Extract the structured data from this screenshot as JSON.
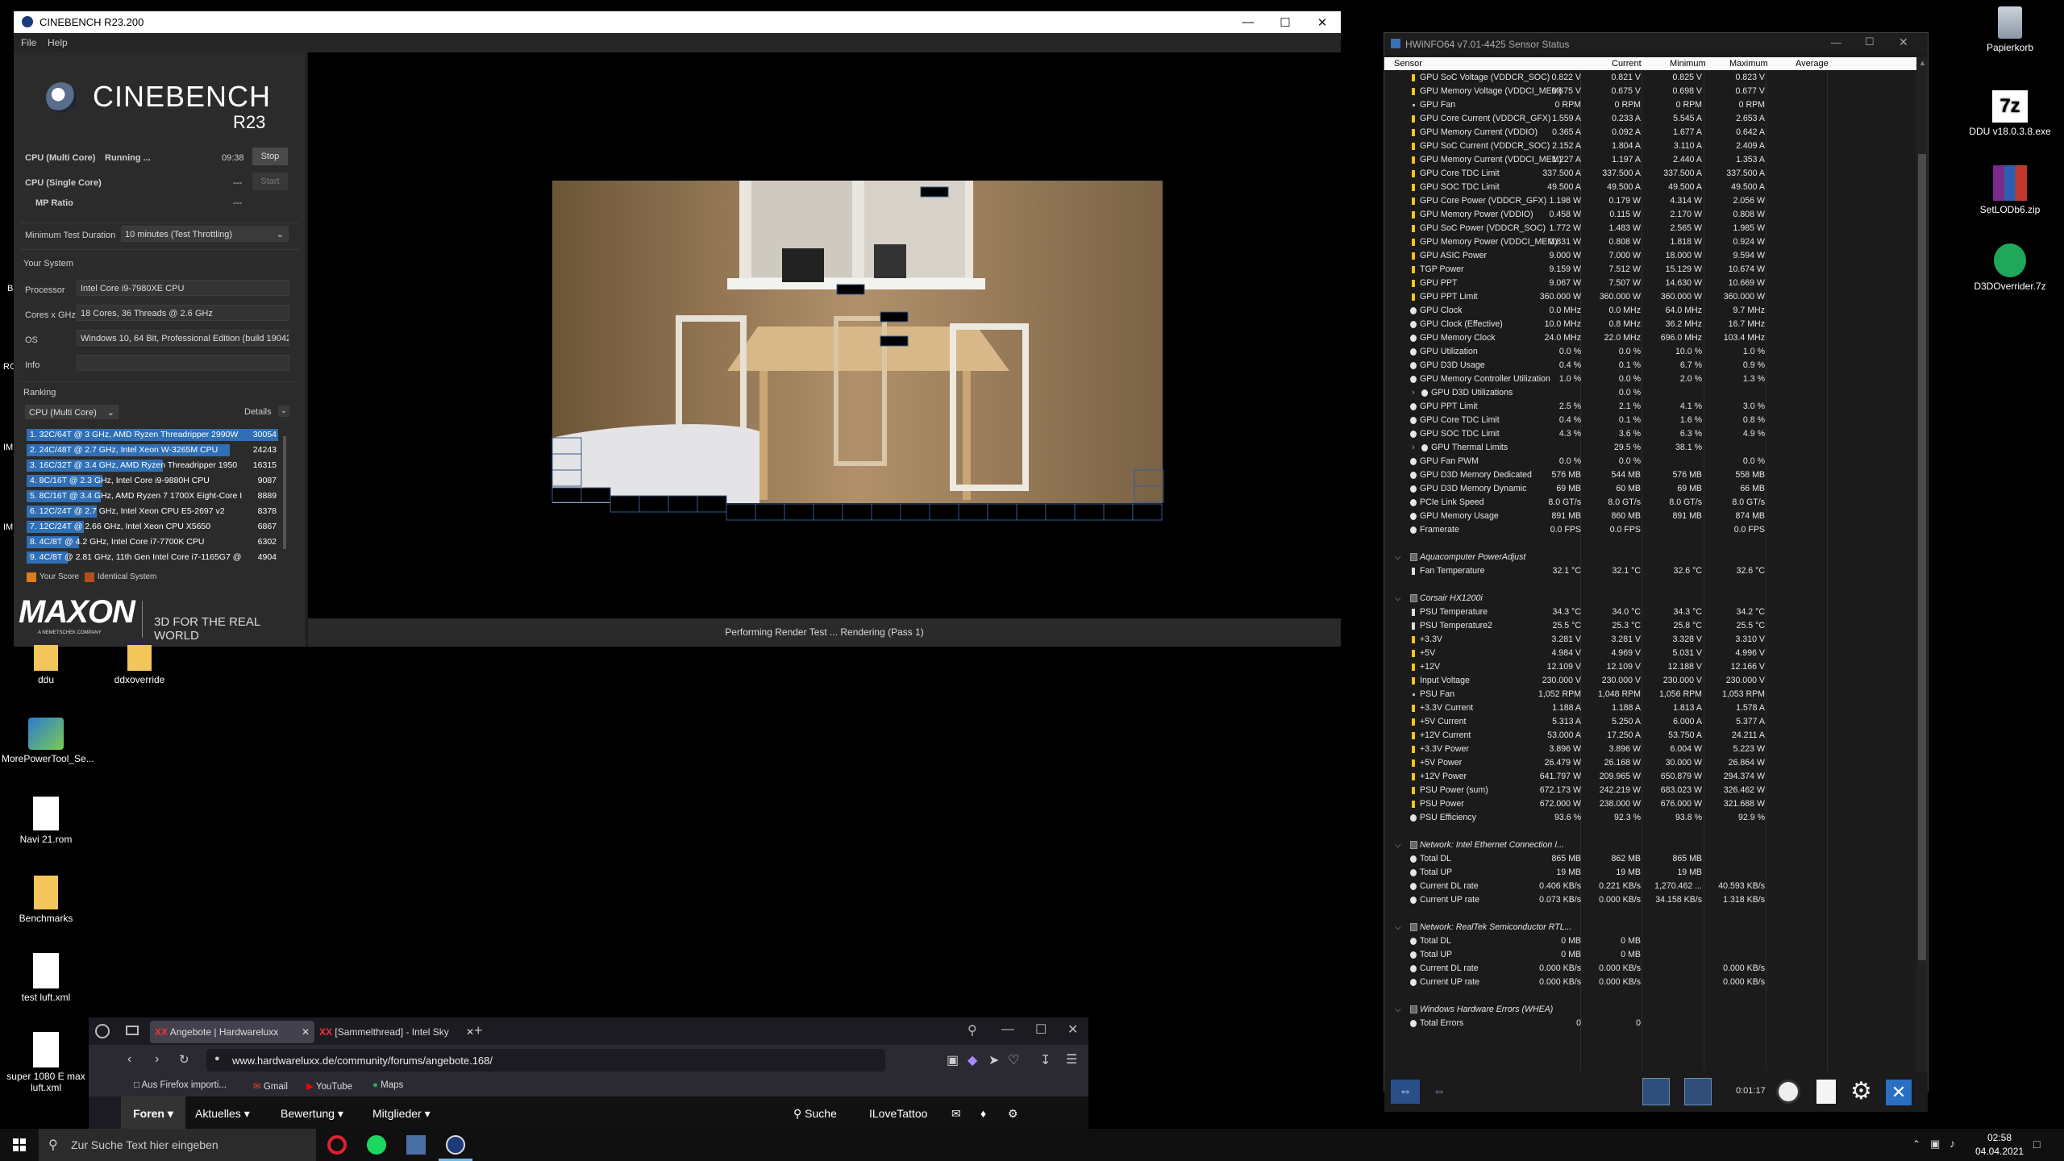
{
  "cinebench": {
    "title": "CINEBENCH R23.200",
    "menu": [
      "File",
      "Help"
    ],
    "logo_text": "CINEBENCH",
    "logo_sub": "R23",
    "tests": [
      {
        "label": "CPU (Multi Core)",
        "status": "Running ...",
        "time": "09:38",
        "button": "Stop"
      },
      {
        "label": "CPU (Single Core)",
        "status": "",
        "time": "---",
        "button": "Start"
      },
      {
        "label": "MP Ratio",
        "status": "",
        "time": "---",
        "button": ""
      }
    ],
    "min_duration_label": "Minimum Test Duration",
    "min_duration_value": "10 minutes (Test Throttling)",
    "system_title": "Your System",
    "system": [
      {
        "key": "Processor",
        "value": "Intel Core i9-7980XE CPU"
      },
      {
        "key": "Cores x GHz",
        "value": "18 Cores, 36 Threads @ 2.6 GHz"
      },
      {
        "key": "OS",
        "value": "Windows 10, 64 Bit, Professional Edition (build 19042"
      },
      {
        "key": "Info",
        "value": ""
      }
    ],
    "ranking_title": "Ranking",
    "ranking_select": "CPU (Multi Core)",
    "details_label": "Details",
    "ranking": [
      {
        "label": "1. 32C/64T @ 3 GHz, AMD Ryzen Threadripper 2990W",
        "score": "30054"
      },
      {
        "label": "2. 24C/48T @ 2.7 GHz, Intel Xeon W-3265M CPU",
        "score": "24243"
      },
      {
        "label": "3. 16C/32T @ 3.4 GHz, AMD Ryzen Threadripper 1950",
        "score": "16315"
      },
      {
        "label": "4. 8C/16T @ 2.3 GHz, Intel Core i9-9880H CPU",
        "score": "9087"
      },
      {
        "label": "5. 8C/16T @ 3.4 GHz, AMD Ryzen 7 1700X Eight-Core I",
        "score": "8889"
      },
      {
        "label": "6. 12C/24T @ 2.7 GHz, Intel Xeon CPU E5-2697 v2",
        "score": "8378"
      },
      {
        "label": "7. 12C/24T @ 2.66 GHz, Intel Xeon CPU X5650",
        "score": "6867"
      },
      {
        "label": "8. 4C/8T @ 4.2 GHz, Intel Core i7-7700K CPU",
        "score": "6302"
      },
      {
        "label": "9. 4C/8T @ 2.81 GHz, 11th Gen Intel Core i7-1165G7 @",
        "score": "4904"
      }
    ],
    "legend_your_score": "Your Score",
    "legend_identical": "Identical System",
    "maxon": "MAXON",
    "maxon_sub": "A NEMETSCHEK COMPANY",
    "tagline": "3D FOR THE REAL WORLD",
    "status": "Performing Render Test ... Rendering (Pass 1)"
  },
  "hwinfo": {
    "title": "HWiNFO64 v7.01-4425 Sensor Status",
    "columns": [
      "Sensor",
      "Current",
      "Minimum",
      "Maximum",
      "Average"
    ],
    "rows": [
      {
        "t": "s",
        "i": "bolt",
        "n": "GPU SoC Voltage (VDDCR_SOC)",
        "c": "0.822 V",
        "mi": "0.821 V",
        "ma": "0.825 V",
        "a": "0.823 V"
      },
      {
        "t": "s",
        "i": "bolt",
        "n": "GPU Memory Voltage (VDDCI_MEM)",
        "c": "0.675 V",
        "mi": "0.675 V",
        "ma": "0.698 V",
        "a": "0.677 V"
      },
      {
        "t": "s",
        "i": "dot",
        "n": "GPU Fan",
        "c": "0 RPM",
        "mi": "0 RPM",
        "ma": "0 RPM",
        "a": "0 RPM"
      },
      {
        "t": "s",
        "i": "bolt",
        "n": "GPU Core Current (VDDCR_GFX)",
        "c": "1.559 A",
        "mi": "0.233 A",
        "ma": "5.545 A",
        "a": "2.653 A"
      },
      {
        "t": "s",
        "i": "bolt",
        "n": "GPU Memory Current (VDDIO)",
        "c": "0.365 A",
        "mi": "0.092 A",
        "ma": "1.677 A",
        "a": "0.642 A"
      },
      {
        "t": "s",
        "i": "bolt",
        "n": "GPU SoC Current (VDDCR_SOC)",
        "c": "2.152 A",
        "mi": "1.804 A",
        "ma": "3.110 A",
        "a": "2.409 A"
      },
      {
        "t": "s",
        "i": "bolt",
        "n": "GPU Memory Current (VDDCI_MEM)",
        "c": "1.227 A",
        "mi": "1.197 A",
        "ma": "2.440 A",
        "a": "1.353 A"
      },
      {
        "t": "s",
        "i": "bolt",
        "n": "GPU Core TDC Limit",
        "c": "337.500 A",
        "mi": "337.500 A",
        "ma": "337.500 A",
        "a": "337.500 A"
      },
      {
        "t": "s",
        "i": "bolt",
        "n": "GPU SOC TDC Limit",
        "c": "49.500 A",
        "mi": "49.500 A",
        "ma": "49.500 A",
        "a": "49.500 A"
      },
      {
        "t": "s",
        "i": "bolt",
        "n": "GPU Core Power (VDDCR_GFX)",
        "c": "1.198 W",
        "mi": "0.179 W",
        "ma": "4.314 W",
        "a": "2.056 W"
      },
      {
        "t": "s",
        "i": "bolt",
        "n": "GPU Memory Power (VDDIO)",
        "c": "0.458 W",
        "mi": "0.115 W",
        "ma": "2.170 W",
        "a": "0.808 W"
      },
      {
        "t": "s",
        "i": "bolt",
        "n": "GPU SoC Power (VDDCR_SOC)",
        "c": "1.772 W",
        "mi": "1.483 W",
        "ma": "2.565 W",
        "a": "1.985 W"
      },
      {
        "t": "s",
        "i": "bolt",
        "n": "GPU Memory Power (VDDCI_MEM)",
        "c": "0.831 W",
        "mi": "0.808 W",
        "ma": "1.818 W",
        "a": "0.924 W"
      },
      {
        "t": "s",
        "i": "bolt",
        "n": "GPU ASIC Power",
        "c": "9.000 W",
        "mi": "7.000 W",
        "ma": "18.000 W",
        "a": "9.594 W"
      },
      {
        "t": "s",
        "i": "bolt",
        "n": "TGP Power",
        "c": "9.159 W",
        "mi": "7.512 W",
        "ma": "15.129 W",
        "a": "10.674 W"
      },
      {
        "t": "s",
        "i": "bolt",
        "n": "GPU PPT",
        "c": "9.067 W",
        "mi": "7.507 W",
        "ma": "14.630 W",
        "a": "10.669 W"
      },
      {
        "t": "s",
        "i": "bolt",
        "n": "GPU PPT Limit",
        "c": "360.000 W",
        "mi": "360.000 W",
        "ma": "360.000 W",
        "a": "360.000 W"
      },
      {
        "t": "s",
        "i": "clock",
        "n": "GPU Clock",
        "c": "0.0 MHz",
        "mi": "0.0 MHz",
        "ma": "64.0 MHz",
        "a": "9.7 MHz"
      },
      {
        "t": "s",
        "i": "clock",
        "n": "GPU Clock (Effective)",
        "c": "10.0 MHz",
        "mi": "0.8 MHz",
        "ma": "36.2 MHz",
        "a": "16.7 MHz"
      },
      {
        "t": "s",
        "i": "clock",
        "n": "GPU Memory Clock",
        "c": "24.0 MHz",
        "mi": "22.0 MHz",
        "ma": "696.0 MHz",
        "a": "103.4 MHz"
      },
      {
        "t": "s",
        "i": "clock",
        "n": "GPU Utilization",
        "c": "0.0 %",
        "mi": "0.0 %",
        "ma": "10.0 %",
        "a": "1.0 %"
      },
      {
        "t": "s",
        "i": "clock",
        "n": "GPU D3D Usage",
        "c": "0.4 %",
        "mi": "0.1 %",
        "ma": "6.7 %",
        "a": "0.9 %"
      },
      {
        "t": "s",
        "i": "clock",
        "n": "GPU Memory Controller Utilization",
        "c": "1.0 %",
        "mi": "0.0 %",
        "ma": "2.0 %",
        "a": "1.3 %"
      },
      {
        "t": "sub",
        "i": "clock",
        "n": "GPU D3D Utilizations",
        "c": "",
        "mi": "0.0 %",
        "ma": "",
        "a": ""
      },
      {
        "t": "s",
        "i": "clock",
        "n": "GPU PPT Limit",
        "c": "2.5 %",
        "mi": "2.1 %",
        "ma": "4.1 %",
        "a": "3.0 %"
      },
      {
        "t": "s",
        "i": "clock",
        "n": "GPU Core TDC Limit",
        "c": "0.4 %",
        "mi": "0.1 %",
        "ma": "1.6 %",
        "a": "0.8 %"
      },
      {
        "t": "s",
        "i": "clock",
        "n": "GPU SOC TDC Limit",
        "c": "4.3 %",
        "mi": "3.6 %",
        "ma": "6.3 %",
        "a": "4.9 %"
      },
      {
        "t": "sub",
        "i": "clock",
        "n": "GPU Thermal Limits",
        "c": "",
        "mi": "29.5 %",
        "ma": "38.1 %",
        "a": ""
      },
      {
        "t": "s",
        "i": "clock",
        "n": "GPU Fan PWM",
        "c": "0.0 %",
        "mi": "0.0 %",
        "ma": "",
        "a": "0.0 %"
      },
      {
        "t": "s",
        "i": "clock",
        "n": "GPU D3D Memory Dedicated",
        "c": "576 MB",
        "mi": "544 MB",
        "ma": "576 MB",
        "a": "558 MB"
      },
      {
        "t": "s",
        "i": "clock",
        "n": "GPU D3D Memory Dynamic",
        "c": "69 MB",
        "mi": "60 MB",
        "ma": "69 MB",
        "a": "66 MB"
      },
      {
        "t": "s",
        "i": "clock",
        "n": "PCIe Link Speed",
        "c": "8.0 GT/s",
        "mi": "8.0 GT/s",
        "ma": "8.0 GT/s",
        "a": "8.0 GT/s"
      },
      {
        "t": "s",
        "i": "clock",
        "n": "GPU Memory Usage",
        "c": "891 MB",
        "mi": "860 MB",
        "ma": "891 MB",
        "a": "874 MB"
      },
      {
        "t": "s",
        "i": "clock",
        "n": "Framerate",
        "c": "0.0 FPS",
        "mi": "0.0 FPS",
        "ma": "",
        "a": "0.0 FPS"
      },
      {
        "t": "blank"
      },
      {
        "t": "g",
        "n": "Aquacomputer PowerAdjust"
      },
      {
        "t": "s",
        "i": "therm",
        "n": "Fan Temperature",
        "c": "32.1 °C",
        "mi": "32.1 °C",
        "ma": "32.6 °C",
        "a": "32.6 °C"
      },
      {
        "t": "blank"
      },
      {
        "t": "g",
        "n": "Corsair HX1200i"
      },
      {
        "t": "s",
        "i": "therm",
        "n": "PSU Temperature",
        "c": "34.3 °C",
        "mi": "34.0 °C",
        "ma": "34.3 °C",
        "a": "34.2 °C"
      },
      {
        "t": "s",
        "i": "therm",
        "n": "PSU Temperature2",
        "c": "25.5 °C",
        "mi": "25.3 °C",
        "ma": "25.8 °C",
        "a": "25.5 °C"
      },
      {
        "t": "s",
        "i": "bolt",
        "n": "+3.3V",
        "c": "3.281 V",
        "mi": "3.281 V",
        "ma": "3.328 V",
        "a": "3.310 V"
      },
      {
        "t": "s",
        "i": "bolt",
        "n": "+5V",
        "c": "4.984 V",
        "mi": "4.969 V",
        "ma": "5.031 V",
        "a": "4.996 V"
      },
      {
        "t": "s",
        "i": "bolt",
        "n": "+12V",
        "c": "12.109 V",
        "mi": "12.109 V",
        "ma": "12.188 V",
        "a": "12.166 V"
      },
      {
        "t": "s",
        "i": "bolt",
        "n": "Input Voltage",
        "c": "230.000 V",
        "mi": "230.000 V",
        "ma": "230.000 V",
        "a": "230.000 V"
      },
      {
        "t": "s",
        "i": "dot",
        "n": "PSU Fan",
        "c": "1,052 RPM",
        "mi": "1,048 RPM",
        "ma": "1,056 RPM",
        "a": "1,053 RPM"
      },
      {
        "t": "s",
        "i": "bolt",
        "n": "+3.3V Current",
        "c": "1.188 A",
        "mi": "1.188 A",
        "ma": "1.813 A",
        "a": "1.578 A"
      },
      {
        "t": "s",
        "i": "bolt",
        "n": "+5V Current",
        "c": "5.313 A",
        "mi": "5.250 A",
        "ma": "6.000 A",
        "a": "5.377 A"
      },
      {
        "t": "s",
        "i": "bolt",
        "n": "+12V Current",
        "c": "53.000 A",
        "mi": "17.250 A",
        "ma": "53.750 A",
        "a": "24.211 A"
      },
      {
        "t": "s",
        "i": "bolt",
        "n": "+3.3V Power",
        "c": "3.896 W",
        "mi": "3.896 W",
        "ma": "6.004 W",
        "a": "5.223 W"
      },
      {
        "t": "s",
        "i": "bolt",
        "n": "+5V Power",
        "c": "26.479 W",
        "mi": "26.168 W",
        "ma": "30.000 W",
        "a": "26.864 W"
      },
      {
        "t": "s",
        "i": "bolt",
        "n": "+12V Power",
        "c": "641.797 W",
        "mi": "209.965 W",
        "ma": "650.879 W",
        "a": "294.374 W"
      },
      {
        "t": "s",
        "i": "bolt",
        "n": "PSU Power (sum)",
        "c": "672.173 W",
        "mi": "242.219 W",
        "ma": "683.023 W",
        "a": "326.462 W"
      },
      {
        "t": "s",
        "i": "bolt",
        "n": "PSU Power",
        "c": "672.000 W",
        "mi": "238.000 W",
        "ma": "676.000 W",
        "a": "321.688 W"
      },
      {
        "t": "s",
        "i": "clock",
        "n": "PSU Efficiency",
        "c": "93.6 %",
        "mi": "92.3 %",
        "ma": "93.8 %",
        "a": "92.9 %"
      },
      {
        "t": "blank"
      },
      {
        "t": "g",
        "n": "Network: Intel Ethernet Connection I..."
      },
      {
        "t": "s",
        "i": "clock",
        "n": "Total DL",
        "c": "865 MB",
        "mi": "862 MB",
        "ma": "865 MB",
        "a": ""
      },
      {
        "t": "s",
        "i": "clock",
        "n": "Total UP",
        "c": "19 MB",
        "mi": "19 MB",
        "ma": "19 MB",
        "a": ""
      },
      {
        "t": "s",
        "i": "clock",
        "n": "Current DL rate",
        "c": "0.406 KB/s",
        "mi": "0.221 KB/s",
        "ma": "1,270.462 ...",
        "a": "40.593 KB/s"
      },
      {
        "t": "s",
        "i": "clock",
        "n": "Current UP rate",
        "c": "0.073 KB/s",
        "mi": "0.000 KB/s",
        "ma": "34.158 KB/s",
        "a": "1.318 KB/s"
      },
      {
        "t": "blank"
      },
      {
        "t": "g",
        "n": "Network: RealTek Semiconductor RTL..."
      },
      {
        "t": "s",
        "i": "clock",
        "n": "Total DL",
        "c": "0 MB",
        "mi": "0 MB",
        "ma": "",
        "a": ""
      },
      {
        "t": "s",
        "i": "clock",
        "n": "Total UP",
        "c": "0 MB",
        "mi": "0 MB",
        "ma": "",
        "a": ""
      },
      {
        "t": "s",
        "i": "clock",
        "n": "Current DL rate",
        "c": "0.000 KB/s",
        "mi": "0.000 KB/s",
        "ma": "",
        "a": "0.000 KB/s"
      },
      {
        "t": "s",
        "i": "clock",
        "n": "Current UP rate",
        "c": "0.000 KB/s",
        "mi": "0.000 KB/s",
        "ma": "",
        "a": "0.000 KB/s"
      },
      {
        "t": "blank"
      },
      {
        "t": "g",
        "n": "Windows Hardware Errors (WHEA)"
      },
      {
        "t": "s",
        "i": "clock",
        "n": "Total Errors",
        "c": "0",
        "mi": "0",
        "ma": "",
        "a": ""
      }
    ],
    "timer": "0:01:17"
  },
  "desktop": {
    "icons_right": [
      {
        "label": "Papierkorb",
        "icon": "recycle-bin-icon"
      },
      {
        "label": "DDU v18.0.3.8.exe",
        "icon": "7zip-icon"
      },
      {
        "label": "SetLODb6.zip",
        "icon": "winrar-icon"
      },
      {
        "label": "D3DOverrider.7z",
        "icon": "7z-archive-icon"
      }
    ],
    "icons_left": [
      {
        "label": "ddu",
        "icon": "folder-icon"
      },
      {
        "label": "ddxoverride",
        "icon": "folder-icon"
      },
      {
        "label": "MorePowerTool_Se...",
        "icon": "app-icon"
      },
      {
        "label": "Navi 21.rom",
        "icon": "file-icon"
      },
      {
        "label": "Benchmarks",
        "icon": "folder-icon"
      },
      {
        "label": "test luft.xml",
        "icon": "xml-file-icon"
      },
      {
        "label": "super 1080 E max luft.xml",
        "icon": "xml-file-icon"
      }
    ],
    "edge_labels": [
      "B",
      "RC",
      "IM",
      "IM"
    ]
  },
  "firefox": {
    "tabs": [
      {
        "title": "Angebote | Hardwareluxx",
        "active": true
      },
      {
        "title": "[Sammelthread] - Intel Sky",
        "active": false
      }
    ],
    "url": "www.hardwareluxx.de/community/forums/angebote.168/",
    "bookmarks": [
      "Aus Firefox importi...",
      "Gmail",
      "YouTube",
      "Maps"
    ],
    "site_nav": [
      "Foren",
      "Aktuelles",
      "Bewertung",
      "Mitglieder"
    ],
    "search_label": "Suche",
    "user_label": "ILoveTattoo"
  },
  "taskbar": {
    "search_placeholder": "Zur Suche Text hier eingeben",
    "time": "02:58",
    "date": "04.04.2021"
  },
  "colors": {
    "cinebench_blue": "#2f6fb5",
    "hwinfo_bg": "#1b1b1b",
    "your_score": "#e07b19",
    "identical": "#b34f1a"
  }
}
